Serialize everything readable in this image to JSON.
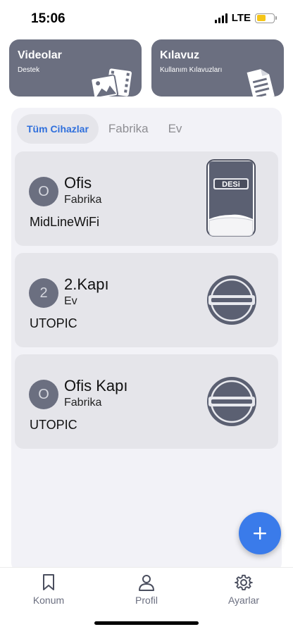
{
  "status": {
    "time": "15:06",
    "network": "LTE",
    "battery_level": 0.55,
    "battery_color": "#f5c518"
  },
  "top_cards": [
    {
      "title": "Videolar",
      "subtitle": "Destek",
      "icon": "media-icon"
    },
    {
      "title": "Kılavuz",
      "subtitle": "Kullanım Kılavuzları",
      "icon": "document-icon"
    }
  ],
  "tabs": [
    {
      "label": "Tüm Cihazlar",
      "active": true
    },
    {
      "label": "Fabrika",
      "active": false
    },
    {
      "label": "Ev",
      "active": false
    }
  ],
  "devices": [
    {
      "initial": "O",
      "name": "Ofis",
      "location": "Fabrika",
      "model": "MidLineWiFi",
      "image": "midline-device-icon",
      "brand": "DESi"
    },
    {
      "initial": "2",
      "name": "2.Kapı",
      "location": "Ev",
      "model": "UTOPIC",
      "image": "utopic-lock-icon"
    },
    {
      "initial": "O",
      "name": "Ofis Kapı",
      "location": "Fabrika",
      "model": "UTOPIC",
      "image": "utopic-lock-icon"
    }
  ],
  "fab": {
    "icon": "plus-icon"
  },
  "nav": [
    {
      "label": "Konum",
      "icon": "bookmark-icon"
    },
    {
      "label": "Profil",
      "icon": "person-icon"
    },
    {
      "label": "Ayarlar",
      "icon": "gear-icon"
    }
  ],
  "colors": {
    "card": "#6b6f80",
    "accent": "#3a7bea",
    "tab_active": "#2f6fdc",
    "panel": "#f2f2f7",
    "device_card": "#e5e5ea"
  }
}
